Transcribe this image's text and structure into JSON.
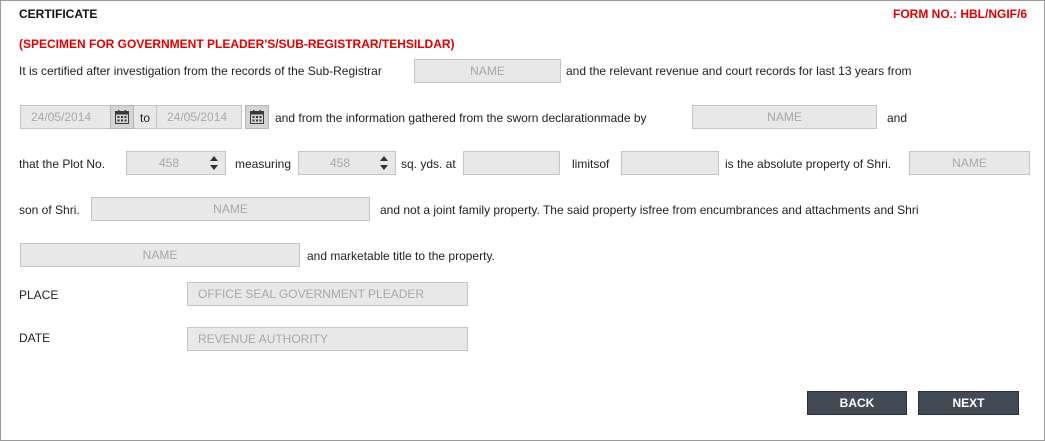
{
  "header": {
    "title": "CERTIFICATE",
    "form_no": "FORM NO.: HBL/NGIF/6"
  },
  "specimen_title": "(SPECIMEN FOR GOVERNMENT PLEADER'S/SUB-REGISTRAR/TEHSILDAR)",
  "text": {
    "line1_a": "It is certified after investigation from the records of the Sub-Registrar",
    "line1_b": "and the relevant revenue and court records for last 13 years from",
    "to": "to",
    "line2_a": "and from the information gathered from the sworn declarationmade by",
    "and": "and",
    "line3_a": "that  the Plot No.",
    "measuring": "measuring",
    "sq_yds": "sq. yds. at",
    "limitsof": "limitsof",
    "absolute": "is the absolute property of Shri.",
    "son_of": "son of Shri.",
    "line4_b": "and not a joint family property. The said property isfree from encumbrances and attachments and Shri",
    "line5_b": "and marketable title to the property.",
    "place": "PLACE",
    "date": "DATE"
  },
  "fields": {
    "subregistrar_name": "NAME",
    "from_date": "24/05/2014",
    "to_date": "24/05/2014",
    "declarant_name": "NAME",
    "plot_no": "458",
    "measuring": "458",
    "location_at": "",
    "limits_of": "",
    "owner_name": "NAME",
    "father_name": "NAME",
    "title_holder_name": "NAME",
    "place": "OFFICE SEAL GOVERNMENT PLEADER",
    "date": "REVENUE AUTHORITY"
  },
  "icons": {
    "calendar": "calendar-icon",
    "spinner": "spinner-arrows-icon"
  },
  "buttons": {
    "back": "BACK",
    "next": "NEXT"
  }
}
